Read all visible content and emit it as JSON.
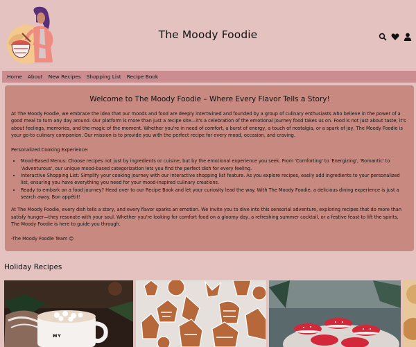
{
  "header": {
    "title": "The Moody Foodie",
    "icons": [
      "search-icon",
      "heart-icon",
      "user-icon"
    ]
  },
  "nav": {
    "items": [
      "Home",
      "About",
      "New Recipes",
      "Shopping List",
      "Recipe Book"
    ]
  },
  "welcome": {
    "heading": "Welcome to The Moody Foodie – Where Every Flavor Tells a Story!",
    "intro": "At The Moody Foodie, we embrace the idea that our moods and food are deeply intertwined and founded by a group of culinary enthusiasts who believe in the power of a good meal to turn any day around. Our platform is more than just a recipe site—it's a celebration of the emotional journey food takes us on. Food is not just about taste; it's about feelings, memories, and the magic of the moment. Whether you're in need of comfort, a burst of energy, a touch of nostalgia, or a spark of joy, The Moody Foodie is your go-to culinary companion. Our mission is to provide you with the perfect recipe for every mood, occasion, and craving.",
    "subheading": "Personalized Cooking Experience:",
    "bullets": [
      "Mood-Based Menus: Choose recipes not just by ingredients or cuisine, but by the emotional experience you seek. From 'Comforting' to 'Energizing', 'Romantic' to 'Adventurous', our unique mood-based categorization lets you find the perfect dish for every feeling.",
      "Interactive Shopping List: Simplify your cooking journey with our interactive shopping list feature. As you explore recipes, easily add ingredients to your personalized list, ensuring you have everything you need for your mood-inspired culinary creations.",
      "Ready to embark on a food journey? Head over to our Recipe Book and let your curiosity lead the way. With The Moody Foodie, a delicious dining experience is just a search away. Bon appétit!"
    ],
    "closing": "At The Moody Foodie, every dish tells a story, and every flavor sparks an emotion. We invite you to dive into this sensorial adventure, exploring recipes that do more than satisfy hunger—they resonate with your soul. Whether you're looking for comfort food on a gloomy day, a refreshing summer cocktail, or a festive feast to lift the spirits, The Moody Foodie is here to guide you through.",
    "signature": "-The Moody Foodie Team 😊"
  },
  "holiday": {
    "title": "Holiday Recipes",
    "cards": [
      "hot-cocoa-image",
      "gingerbread-cookies-image",
      "red-macarons-image",
      "partial-recipe-image"
    ]
  }
}
